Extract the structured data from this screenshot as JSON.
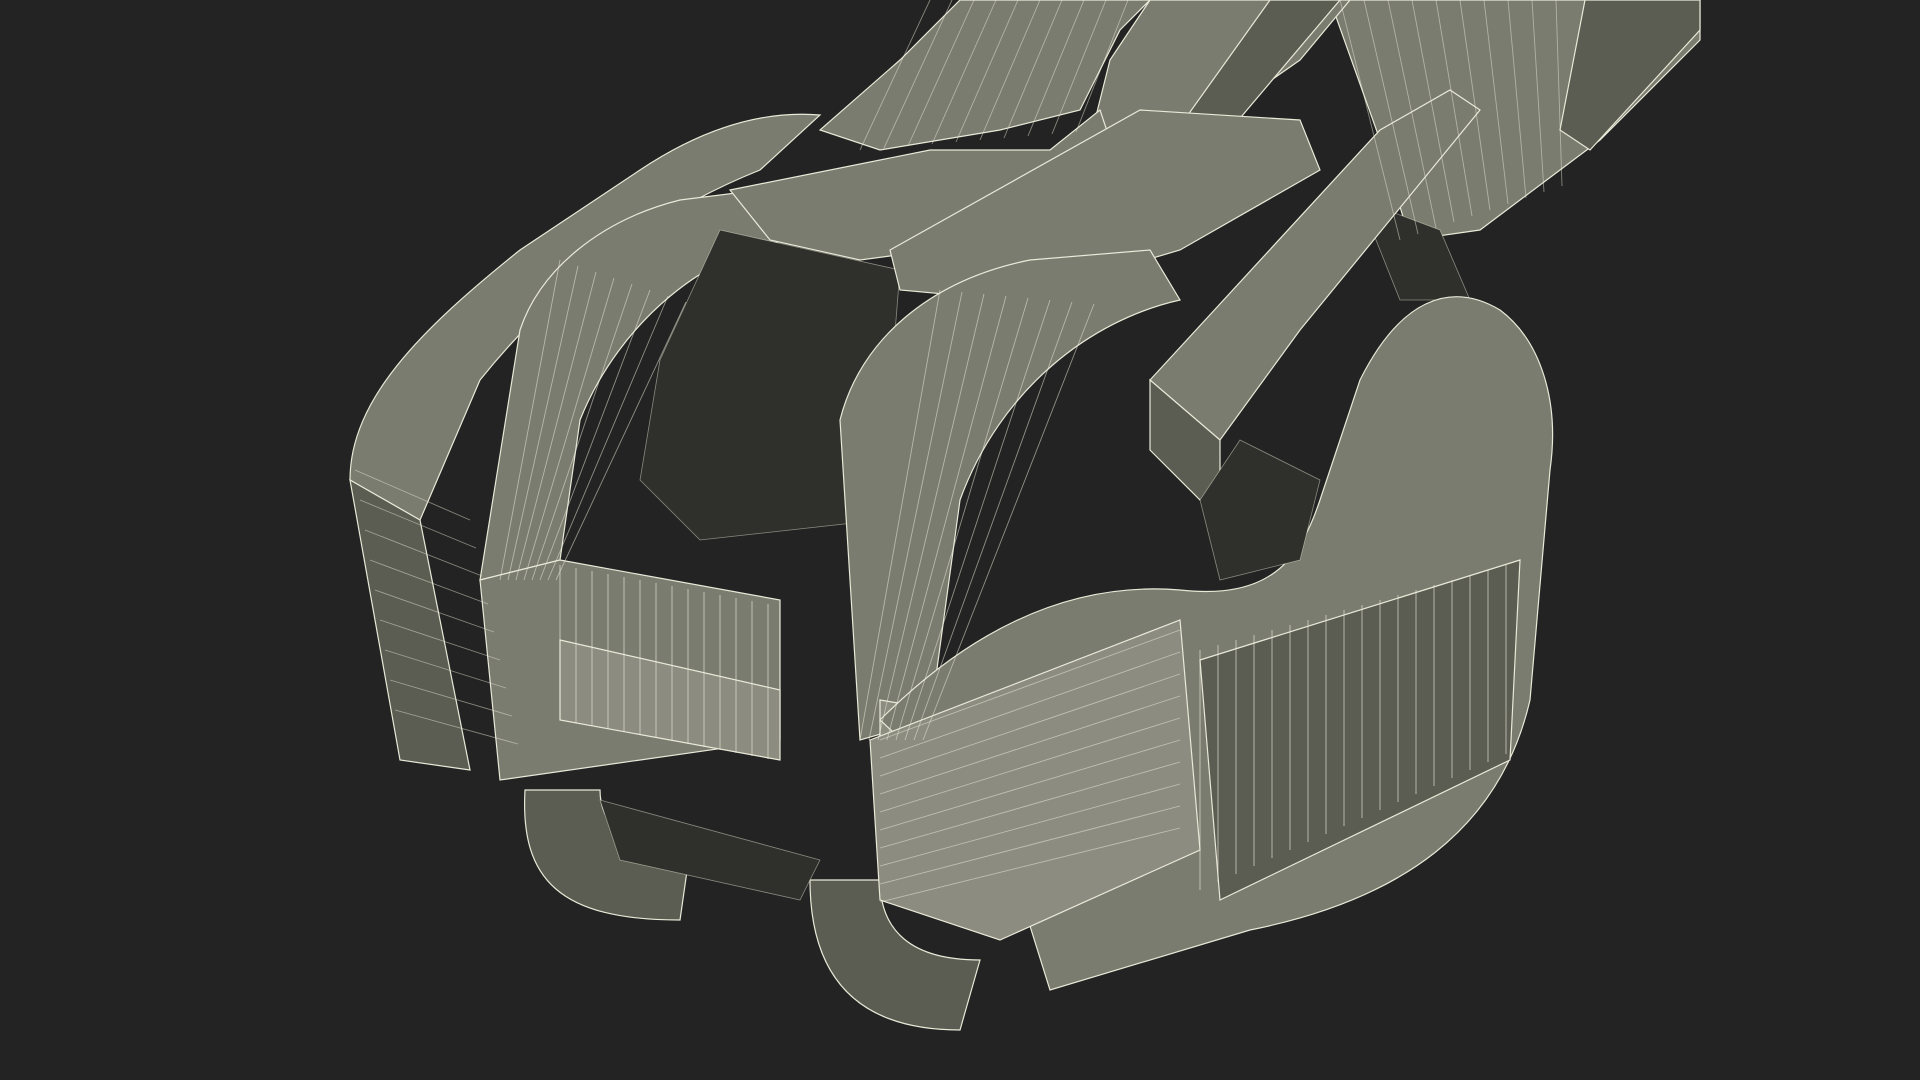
{
  "viewport": {
    "background_color": "#232323"
  },
  "model": {
    "subject": "zipper-slider-wireframe-render",
    "material": {
      "surface_color": "#7b7c70",
      "surface_light": "#8c8d80",
      "surface_dark": "#5b5c52",
      "inner_shadow": "#2f302b",
      "wire_color": "#e9e9d8"
    }
  }
}
